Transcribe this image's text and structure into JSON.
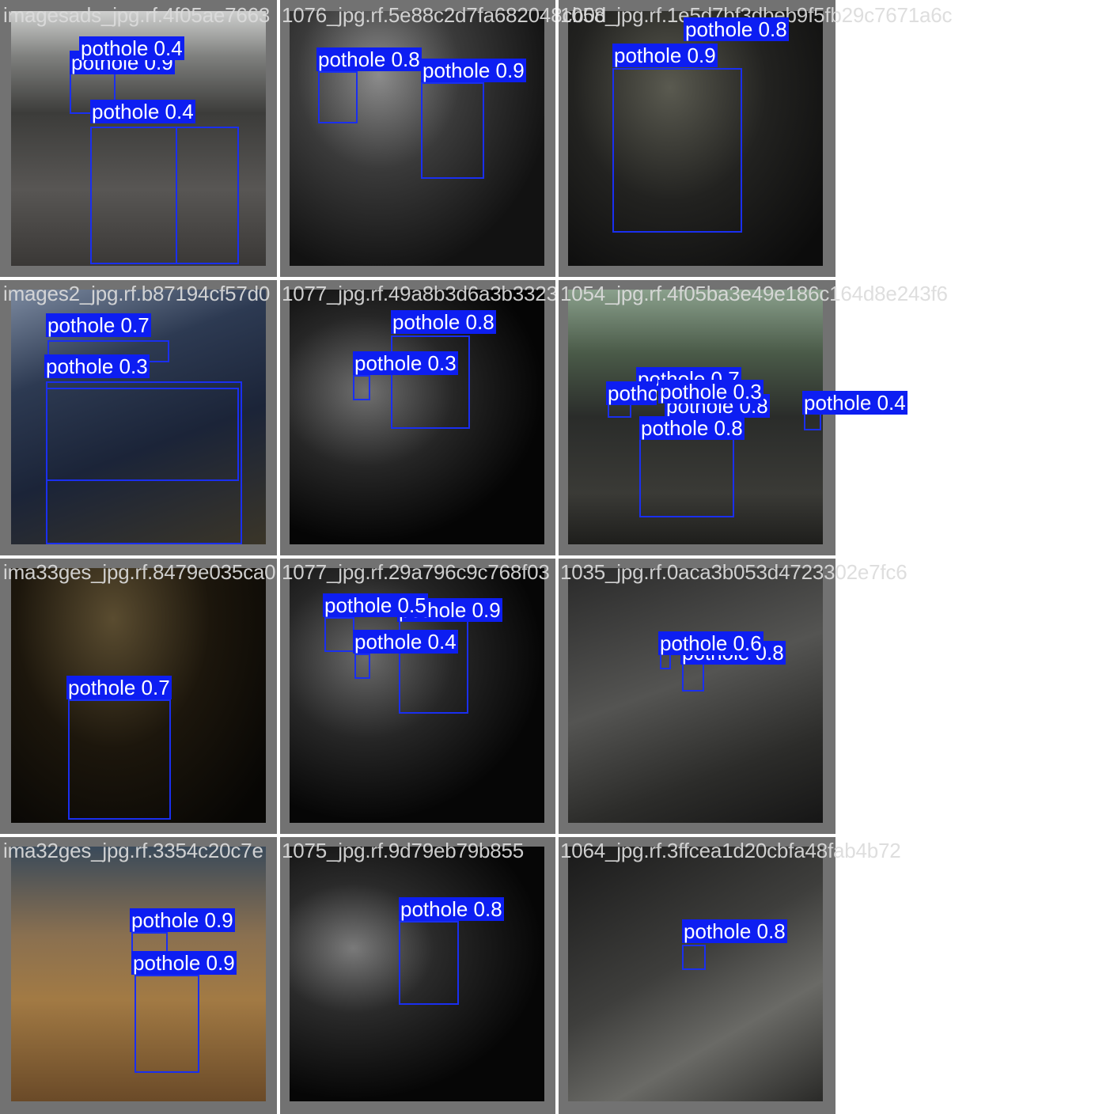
{
  "colors": {
    "box": "#1a2ff0",
    "label_bg": "#0d1ef2",
    "label_text": "#ffffff",
    "frame": "#727272",
    "filename_text": "#dcdcdc"
  },
  "tiles": [
    {
      "filename": "imagesads_jpg.rf.4f05ae7663",
      "photo": "linear-gradient(180deg,#cfd0cf 0%,#7e7f7d 18%,#3c3c3a 40%,#585654 70%,#3a3836 100%)",
      "labels": [
        "pothole 0.4",
        "pothole 0.9",
        "pothole 0.4"
      ]
    },
    {
      "filename": "1076_jpg.rf.5e88c2d7fa682048cb0d",
      "photo": "radial-gradient(ellipse at 35% 25%,#8c8c8c 0%,#3a3a3a 35%,#121212 75%)",
      "labels": [
        "pothole 0.8",
        "pothole 0.9"
      ]
    },
    {
      "filename": "1058_jpg.rf.1e5d7bf3dbeb9f5fb29c7671a6c",
      "photo": "radial-gradient(ellipse at 40% 30%,#5a5a50 0%,#222220 45%,#0c0c0c 90%)",
      "labels": [
        "pothole 0.8",
        "pothole 0.9"
      ]
    },
    {
      "filename": "images2_jpg.rf.b87194cf57d0",
      "photo": "linear-gradient(160deg,#7c8aa0 0%,#2d3a52 30%,#1b2438 60%,#3a3528 100%)",
      "labels": [
        "pothole 0.7",
        "pothole 0.3"
      ]
    },
    {
      "filename": "1077_jpg.rf.49a8b3d6a3b3323",
      "photo": "radial-gradient(ellipse at 30% 40%,#707070 0%,#262626 35%,#050505 70%)",
      "labels": [
        "pothole 0.8",
        "pothole 0.3"
      ]
    },
    {
      "filename": "1054_jpg.rf.4f05ba3e49e186c164d8e243f6",
      "photo": "linear-gradient(180deg,#8aa08c 0%,#4a5a48 25%,#2a2c2a 50%,#3a3a36 80%,#1e1e1c 100%)",
      "labels": [
        "pothole 0.7",
        "pothole 0.3",
        "pothole 0.8",
        "pothole 0.8",
        "pothole 0.8",
        "pothole 0.4"
      ]
    },
    {
      "filename": "ima33ges_jpg.rf.8479e035ca0",
      "photo": "radial-gradient(ellipse at 40% 20%,#5a4c30 0%,#1c160c 45%,#070604 90%)",
      "labels": [
        "pothole 0.7"
      ]
    },
    {
      "filename": "1077_jpg.rf.29a796c9c768f03",
      "photo": "radial-gradient(ellipse at 30% 35%,#6a6a6a 0%,#262626 35%,#060606 70%)",
      "labels": [
        "pothole 0.5",
        "pothole 0.9",
        "pothole 0.4"
      ]
    },
    {
      "filename": "1035_jpg.rf.0aca3b053d4723302e7fc6",
      "photo": "linear-gradient(160deg,#2a2a2a 0%,#545452 45%,#2c2c2a 75%,#161616 100%)",
      "labels": [
        "pothole 0.6",
        "pothole 0.8"
      ]
    },
    {
      "filename": "ima32ges_jpg.rf.3354c20c7e",
      "photo": "linear-gradient(180deg,#3a4a5a 0%,#8a7050 35%,#a27a44 60%,#6a4a28 100%)",
      "labels": [
        "pothole 0.9",
        "pothole 0.9"
      ]
    },
    {
      "filename": "1075_jpg.rf.9d79eb79b855",
      "photo": "radial-gradient(ellipse at 25% 40%,#7a7a7a 0%,#2a2a2a 30%,#060606 70%)",
      "labels": [
        "pothole 0.8"
      ]
    },
    {
      "filename": "1064_jpg.rf.3ffcea1d20cbfa48fab4b72",
      "photo": "linear-gradient(150deg,#1a1a1a 0%,#3e3e3c 45%,#6a6a66 70%,#2a2a28 100%)",
      "labels": [
        "pothole 0.8"
      ]
    }
  ]
}
